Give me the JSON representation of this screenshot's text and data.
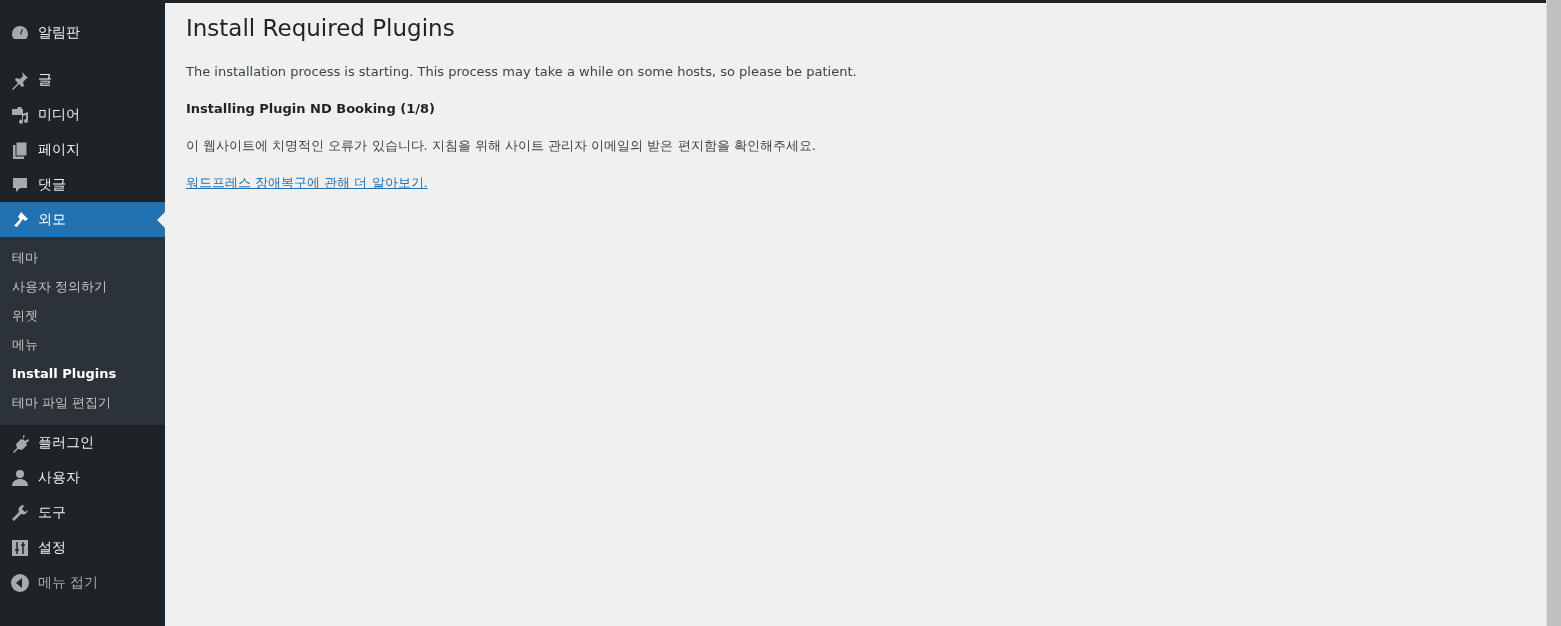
{
  "sidebar": {
    "items": [
      {
        "label": "알림판",
        "selected": false
      },
      {
        "label": "글",
        "selected": false
      },
      {
        "label": "미디어",
        "selected": false
      },
      {
        "label": "페이지",
        "selected": false
      },
      {
        "label": "댓글",
        "selected": false
      },
      {
        "label": "외모",
        "selected": true,
        "children": [
          {
            "label": "테마",
            "selected": false
          },
          {
            "label": "사용자 정의하기",
            "selected": false
          },
          {
            "label": "위젯",
            "selected": false
          },
          {
            "label": "메뉴",
            "selected": false
          },
          {
            "label": "Install Plugins",
            "selected": true
          },
          {
            "label": "테마 파일 편집기",
            "selected": false
          }
        ]
      },
      {
        "label": "플러그인",
        "selected": false
      },
      {
        "label": "사용자",
        "selected": false
      },
      {
        "label": "도구",
        "selected": false
      },
      {
        "label": "설정",
        "selected": false
      }
    ],
    "collapse": {
      "label": "메뉴 접기"
    }
  },
  "main": {
    "title": "Install Required Plugins",
    "intro": "The installation process is starting. This process may take a while on some hosts, so please be patient.",
    "status": "Installing Plugin ND Booking (1/8)",
    "error": "이 웹사이트에 치명적인 오류가 있습니다. 지침을 위해 사이트 관리자 이메일의 받은 편지함을 확인해주세요.",
    "link": "워드프레스 장애복구에 관해 더 알아보기."
  }
}
